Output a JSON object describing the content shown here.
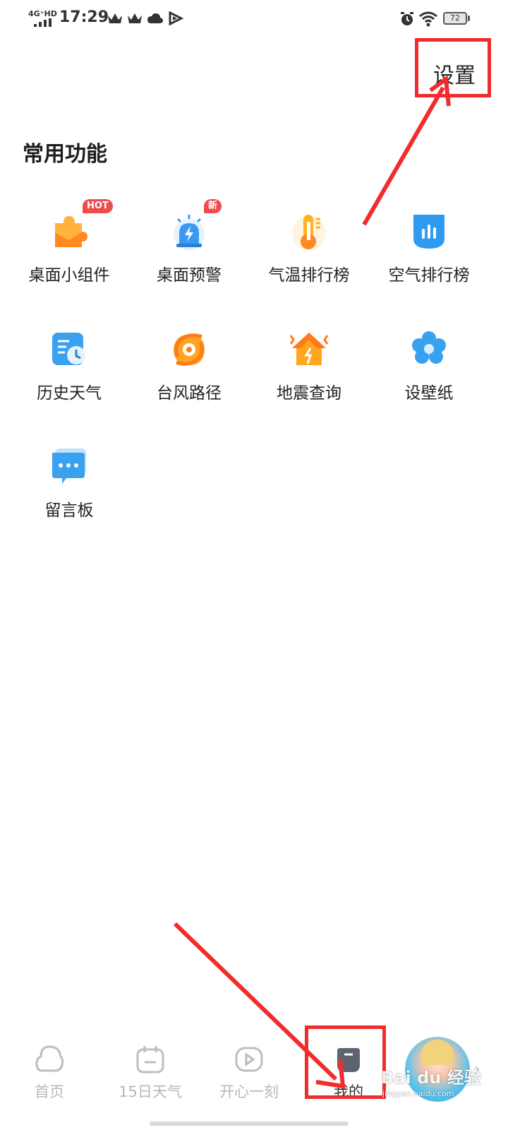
{
  "status_bar": {
    "network": "4G⁺HD",
    "time": "17:29",
    "battery": "72"
  },
  "header": {
    "settings_label": "设置"
  },
  "section": {
    "title": "常用功能"
  },
  "features": [
    {
      "label": "桌面小组件",
      "icon": "puzzle-icon",
      "badge": "HOT"
    },
    {
      "label": "桌面预警",
      "icon": "alarm-light-icon",
      "badge": "新"
    },
    {
      "label": "气温排行榜",
      "icon": "thermometer-icon",
      "badge": ""
    },
    {
      "label": "空气排行榜",
      "icon": "air-bars-icon",
      "badge": ""
    },
    {
      "label": "历史天气",
      "icon": "history-clock-icon",
      "badge": ""
    },
    {
      "label": "台风路径",
      "icon": "typhoon-icon",
      "badge": ""
    },
    {
      "label": "地震查询",
      "icon": "earthquake-house-icon",
      "badge": ""
    },
    {
      "label": "设壁纸",
      "icon": "flower-icon",
      "badge": ""
    },
    {
      "label": "留言板",
      "icon": "message-bubble-icon",
      "badge": ""
    }
  ],
  "bottom_nav": [
    {
      "label": "首页",
      "icon": "home-cloud-icon"
    },
    {
      "label": "15日天气",
      "icon": "calendar-icon"
    },
    {
      "label": "开心一刻",
      "icon": "play-icon"
    },
    {
      "label": "我的",
      "icon": "profile-box-icon"
    }
  ],
  "watermark": {
    "text": "Bai du 经验",
    "sub": "jingyan.baidu.com"
  },
  "colors": {
    "annotation_red": "#f22c2c",
    "badge_red": "#ef4b4b",
    "nav_inactive": "#b8b8b8"
  }
}
